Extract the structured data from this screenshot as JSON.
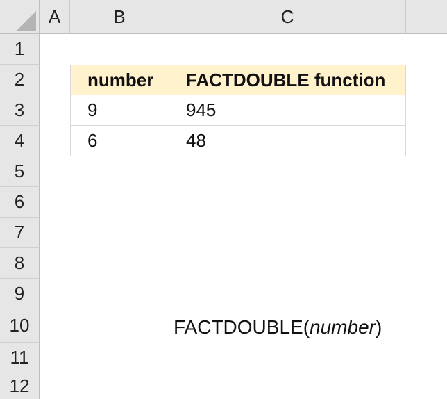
{
  "columns": [
    "A",
    "B",
    "C"
  ],
  "rows": [
    "1",
    "2",
    "3",
    "4",
    "5",
    "6",
    "7",
    "8",
    "9",
    "10",
    "11",
    "12"
  ],
  "table": {
    "headers": [
      "number",
      "FACTDOUBLE function"
    ],
    "rows": [
      [
        "9",
        "945"
      ],
      [
        "6",
        "48"
      ]
    ]
  },
  "syntax": {
    "fn": "FACTDOUBLE(",
    "arg": "number",
    "close": " )"
  }
}
